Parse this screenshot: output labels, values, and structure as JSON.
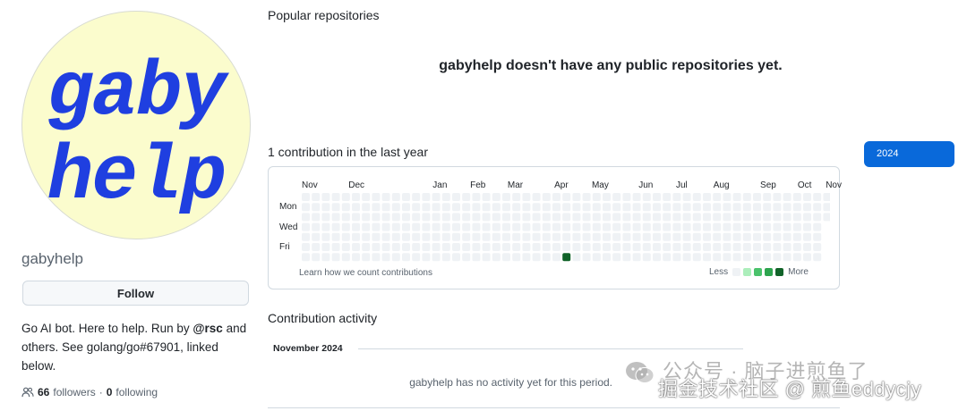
{
  "profile": {
    "avatar_text_line1": "gaby",
    "avatar_text_line2": "help",
    "username": "gabyhelp",
    "follow_label": "Follow",
    "bio_part1": "Go AI bot. Here to help. Run by ",
    "bio_mention": "@rsc",
    "bio_part2": " and others. See golang/go#67901, linked below.",
    "followers_count": "66",
    "followers_label": "followers",
    "separator": "·",
    "following_count": "0",
    "following_label": "following"
  },
  "repositories": {
    "title": "Popular repositories",
    "empty_message": "gabyhelp doesn't have any public repositories yet."
  },
  "contributions": {
    "title": "1 contribution in the last year",
    "year_button": "2024",
    "months": [
      "Nov",
      "Dec",
      "Jan",
      "Feb",
      "Mar",
      "Apr",
      "May",
      "Jun",
      "Jul",
      "Aug",
      "Sep",
      "Oct",
      "Nov"
    ],
    "day_labels": [
      "Mon",
      "Wed",
      "Fri"
    ],
    "weeks": 53,
    "active_cell": {
      "week": 26,
      "day": 6,
      "level": 4
    },
    "learn_link": "Learn how we count contributions",
    "legend_less": "Less",
    "legend_more": "More",
    "level_colors": [
      "#eff2f5",
      "#aceebb",
      "#4ac26b",
      "#2da44e",
      "#116329"
    ]
  },
  "activity": {
    "title": "Contribution activity",
    "month_heading": "November 2024",
    "empty_message": "gabyhelp has no activity yet for this period."
  },
  "watermark": {
    "line1": "公众号 · 脑子进煎鱼了",
    "line2": "掘金技术社区 @ 煎鱼eddycjy"
  }
}
